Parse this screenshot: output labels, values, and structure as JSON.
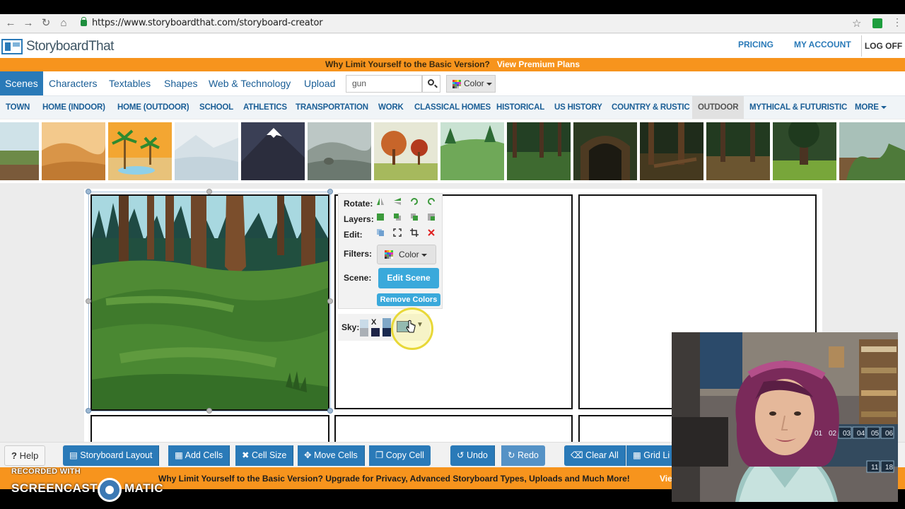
{
  "browser": {
    "url": "https://www.storyboardthat.com/storyboard-creator",
    "icons": [
      "back-arrow",
      "forward-arrow",
      "reload",
      "home",
      "lock",
      "star",
      "extension",
      "menu"
    ]
  },
  "header": {
    "logo_text": "StoryboardThat",
    "pricing": "PRICING",
    "my_account": "MY ACCOUNT",
    "log_off": "LOG OFF"
  },
  "promo_top": {
    "question": "Why Limit Yourself to the Basic Version?",
    "link": "View Premium Plans"
  },
  "tabs": {
    "scenes": "Scenes",
    "characters": "Characters",
    "textables": "Textables",
    "shapes": "Shapes",
    "web_tech": "Web & Technology",
    "upload": "Upload",
    "search_value": "gun",
    "color_label": "Color"
  },
  "categories": {
    "town": "TOWN",
    "home_indoor": "HOME (INDOOR)",
    "home_outdoor": "HOME (OUTDOOR)",
    "school": "SCHOOL",
    "athletics": "ATHLETICS",
    "transportation": "TRANSPORTATION",
    "work": "WORK",
    "classical_homes": "CLASSICAL HOMES",
    "historical": "HISTORICAL",
    "us_history": "US HISTORY",
    "country_rustic": "COUNTRY & RUSTIC",
    "outdoor": "OUTDOOR",
    "mythical": "MYTHICAL & FUTURISTIC",
    "more": "MORE",
    "selected": "OUTDOOR"
  },
  "context_menu": {
    "rotate": "Rotate:",
    "layers": "Layers:",
    "edit": "Edit:",
    "filters": "Filters:",
    "filter_value": "Color",
    "scene": "Scene:",
    "edit_scene": "Edit Scene",
    "remove_colors": "Remove Colors",
    "sky": "Sky:",
    "sky_x": "X"
  },
  "toolbar": {
    "help": "Help",
    "storyboard_layout": "Storyboard Layout",
    "add_cells": "Add Cells",
    "cell_size": "Cell Size",
    "move_cells": "Move Cells",
    "copy_cell": "Copy Cell",
    "undo": "Undo",
    "redo": "Redo",
    "clear_all": "Clear All",
    "grid_lines": "Grid Li"
  },
  "promo_bottom": {
    "text": "Why Limit Yourself to the Basic Version? Upgrade for Privacy, Advanced Storyboard Types, Uploads and Much More!",
    "link": "Vie"
  },
  "watermark": {
    "top": "RECORDED WITH",
    "left": "SCREENCAST",
    "right": "MATIC"
  },
  "webcam": {
    "calendar_numbers": [
      "01",
      "02",
      "03",
      "04",
      "05",
      "06"
    ],
    "calendar_numbers_row2": [
      "11",
      "18"
    ]
  },
  "colors": {
    "brand_blue": "#2a7ab8",
    "promo_orange": "#f7941d",
    "button_cyan": "#3aa9db"
  }
}
